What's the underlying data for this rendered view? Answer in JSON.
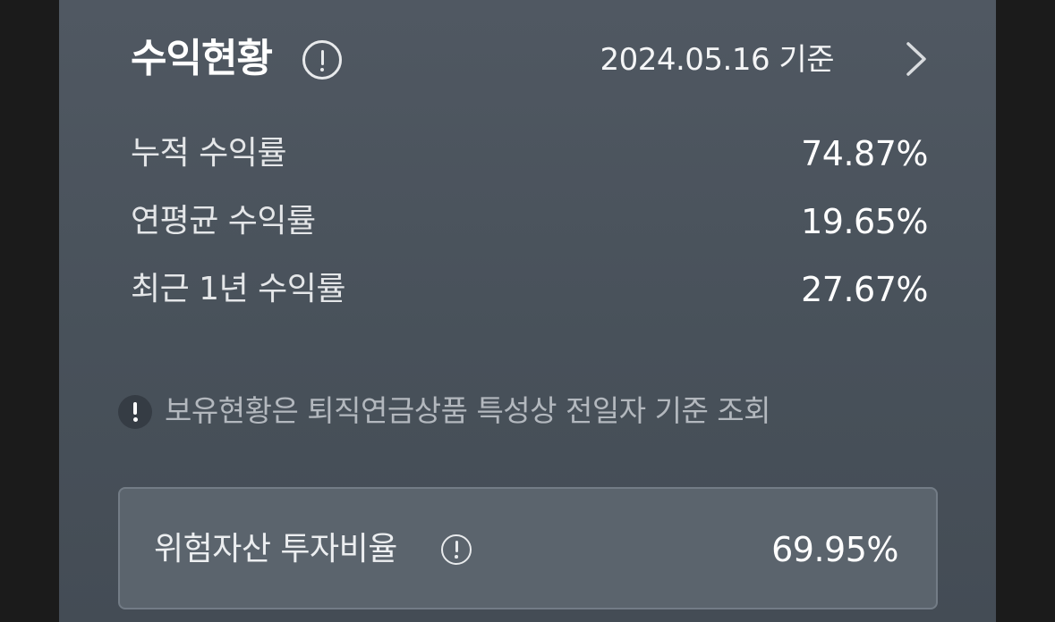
{
  "header": {
    "title": "수익현황",
    "info_icon": "info-circle-icon",
    "date": "2024.05.16 기준",
    "chevron_icon": "chevron-right-icon"
  },
  "returns": {
    "rows": [
      {
        "label": "누적 수익률",
        "value": "74.87%"
      },
      {
        "label": "연평균 수익률",
        "value": "19.65%"
      },
      {
        "label": "최근 1년 수익률",
        "value": "27.67%"
      }
    ]
  },
  "notice": {
    "icon": "exclamation-circle-icon",
    "text": "보유현황은 퇴직연금상품 특성상 전일자 기준 조회"
  },
  "risk": {
    "label": "위험자산 투자비율",
    "info_icon": "info-circle-icon",
    "value": "69.95%"
  },
  "colors": {
    "panel_background": "#4b535c",
    "page_background": "#1b1b1b",
    "risk_box_background": "#5b646d",
    "text_primary": "#ffffff",
    "text_secondary": "#b3b8be"
  }
}
